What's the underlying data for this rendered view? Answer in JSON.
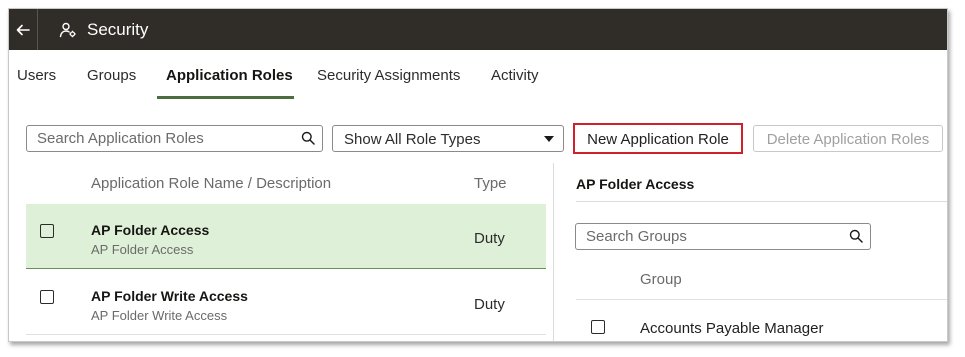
{
  "header": {
    "title": "Security",
    "back_icon": "arrow-left-icon",
    "title_icon": "users-gear-icon",
    "background": "#302c28"
  },
  "tabs": [
    {
      "label": "Users",
      "active": false
    },
    {
      "label": "Groups",
      "active": false
    },
    {
      "label": "Application Roles",
      "active": true
    },
    {
      "label": "Security Assignments",
      "active": false
    },
    {
      "label": "Activity",
      "active": false
    }
  ],
  "toolbar": {
    "search_placeholder": "Search Application Roles",
    "filter_value": "Show All Role Types",
    "new_button_label": "New Application Role",
    "delete_button_label": "Delete Application Roles",
    "highlight_color": "#d0202a"
  },
  "roles_table": {
    "columns": [
      "Application Role Name / Description",
      "Type"
    ],
    "rows": [
      {
        "name": "AP Folder Access",
        "description": "AP Folder Access",
        "type": "Duty",
        "selected": true
      },
      {
        "name": "AP Folder Write Access",
        "description": "AP Folder Write Access",
        "type": "Duty",
        "selected": false
      }
    ]
  },
  "detail_panel": {
    "title": "AP Folder Access",
    "search_placeholder": "Search Groups",
    "column": "Group",
    "groups": [
      "Accounts Payable Manager"
    ]
  }
}
